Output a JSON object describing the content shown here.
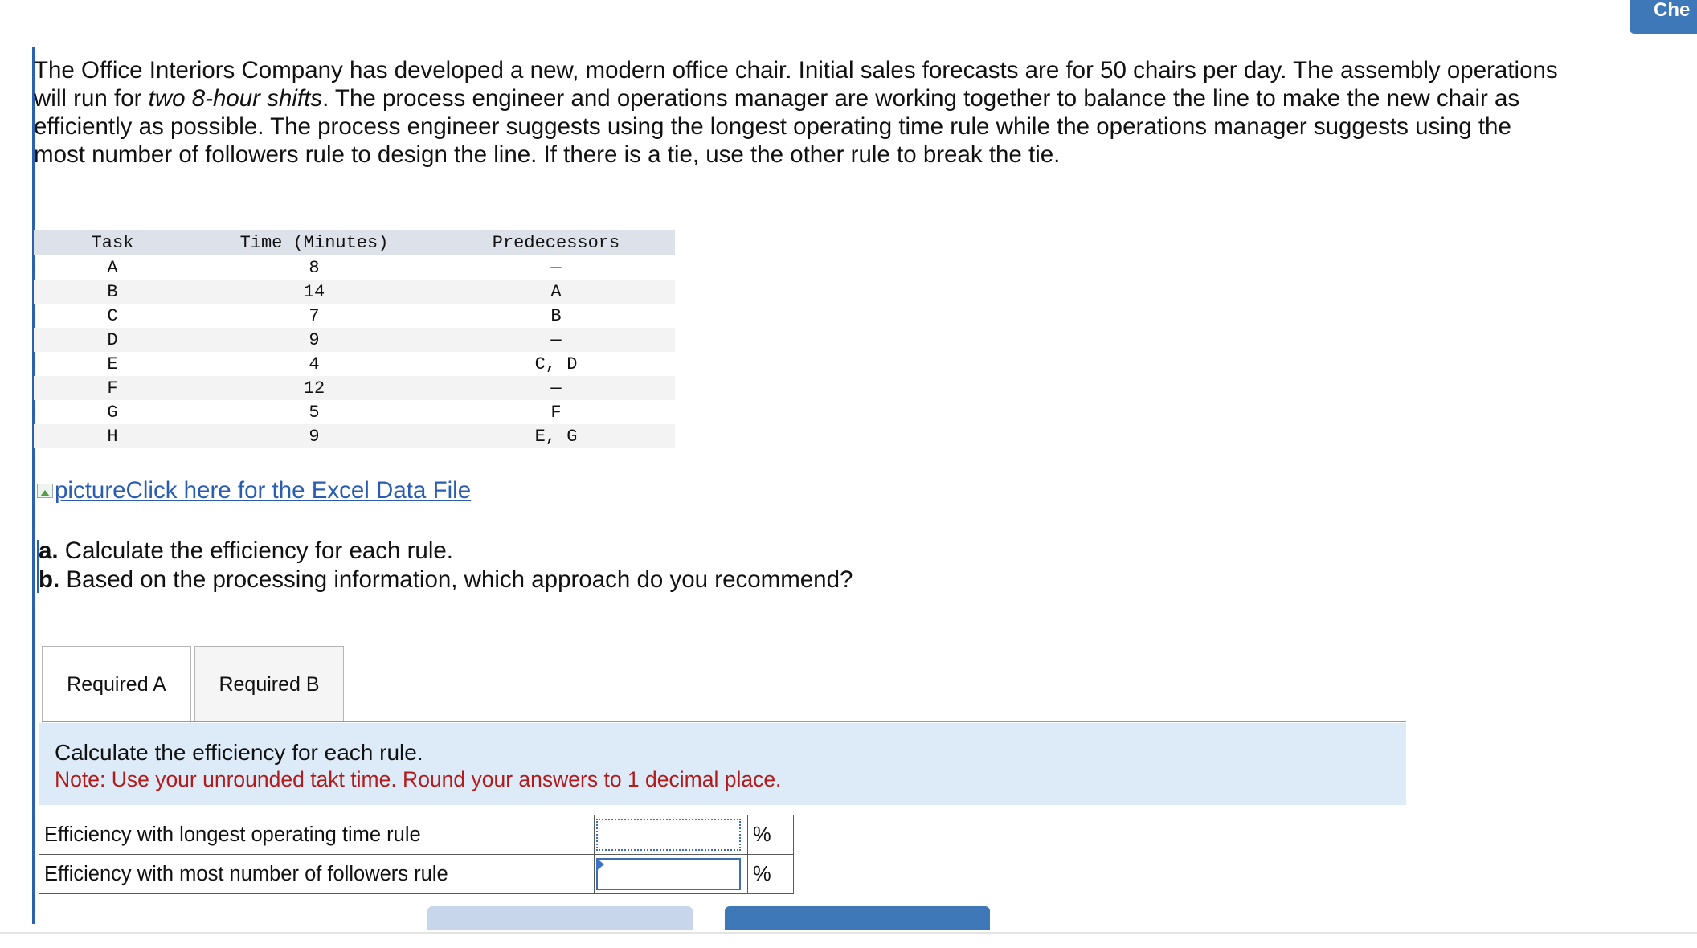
{
  "header": {
    "check_label": "Che"
  },
  "problem": {
    "intro_1": "The Office Interiors Company has developed a new, modern office chair. Initial sales forecasts are for 50 chairs per day. The assembly operations will run for ",
    "intro_em": "two 8-hour shifts",
    "intro_2": ". The process engineer and operations manager are working together to balance the line to make the new chair as efficiently as possible. The process engineer suggests using the longest operating time rule while the operations manager suggests using the most number of followers rule to design the line. If there is a tie, use the other rule to break the tie."
  },
  "task_table": {
    "headers": [
      "Task",
      "Time (Minutes)",
      "Predecessors"
    ],
    "rows": [
      [
        "A",
        "8",
        "—"
      ],
      [
        "B",
        "14",
        "A"
      ],
      [
        "C",
        "7",
        "B"
      ],
      [
        "D",
        "9",
        "—"
      ],
      [
        "E",
        "4",
        "C, D"
      ],
      [
        "F",
        "12",
        "—"
      ],
      [
        "G",
        "5",
        "F"
      ],
      [
        "H",
        "9",
        "E, G"
      ]
    ]
  },
  "excel_link": {
    "img_alt": "picture",
    "text": "Click here for the Excel Data File"
  },
  "questions": {
    "a_label": "a.",
    "a_text": " Calculate the efficiency for each rule.",
    "b_label": "b.",
    "b_text": " Based on the processing information, which approach do you recommend?"
  },
  "tabs": [
    {
      "label": "Required A"
    },
    {
      "label": "Required B"
    }
  ],
  "instructions": {
    "line1": "Calculate the efficiency for each rule.",
    "line2": "Note: Use your unrounded takt time. Round your answers to 1 decimal place."
  },
  "answers": {
    "rows": [
      {
        "label": "Efficiency with longest operating time rule",
        "value": "",
        "unit": "%"
      },
      {
        "label": "Efficiency with most number of followers rule",
        "value": "",
        "unit": "%"
      }
    ]
  }
}
